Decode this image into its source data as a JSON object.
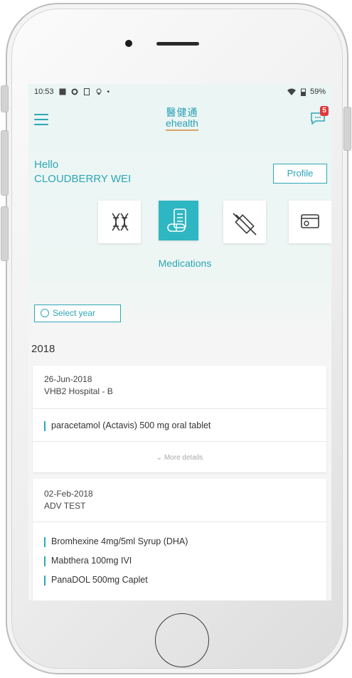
{
  "status_bar": {
    "time": "10:53",
    "battery": "59%"
  },
  "header": {
    "logo_zh": "醫健通",
    "logo_en": "ehealth",
    "notification_count": "5"
  },
  "greeting": {
    "line1": "Hello",
    "line2": "CLOUDBERRY WEI"
  },
  "profile_button": "Profile",
  "categories": [
    {
      "icon": "dna-icon",
      "active": false
    },
    {
      "icon": "medications-icon",
      "active": true
    },
    {
      "icon": "syringe-icon",
      "active": false
    },
    {
      "icon": "card-icon",
      "active": false
    }
  ],
  "active_category_label": "Medications",
  "select_year_label": "Select year",
  "year": "2018",
  "records": [
    {
      "date": "26-Jun-2018",
      "hospital": "VHB2 Hospital - B",
      "medications": [
        "paracetamol (Actavis) 500 mg oral tablet"
      ],
      "more_details": "More details"
    },
    {
      "date": "02-Feb-2018",
      "hospital": "ADV TEST",
      "medications": [
        "Bromhexine 4mg/5ml Syrup (DHA)",
        "Mabthera 100mg IVI",
        "PanaDOL 500mg Caplet"
      ]
    }
  ],
  "colors": {
    "accent": "#2ea7b4",
    "active_tile": "#2eb6c2",
    "badge": "#e0393e"
  }
}
